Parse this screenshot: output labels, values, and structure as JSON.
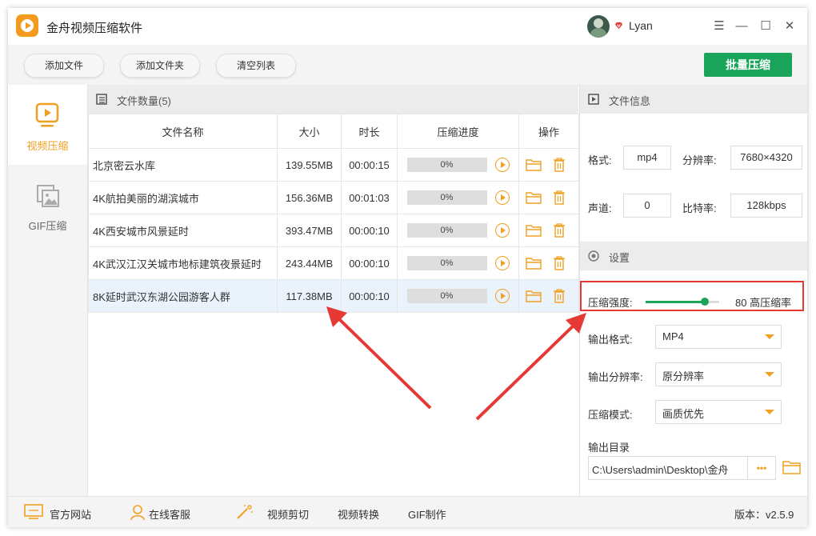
{
  "app": {
    "title": "金舟视频压缩软件",
    "username": "Lyan"
  },
  "window_controls": {
    "menu": "☰",
    "minimize": "—",
    "maximize": "☐",
    "close": "✕"
  },
  "toolbar": {
    "add_file": "添加文件",
    "add_folder": "添加文件夹",
    "clear_list": "清空列表",
    "batch_compress": "批量压缩"
  },
  "nav": {
    "items": [
      {
        "label": "视频压缩",
        "icon": "video-play-icon",
        "active": true
      },
      {
        "label": "GIF压缩",
        "icon": "image-icon",
        "active": false
      }
    ]
  },
  "file_panel": {
    "header": "文件数量(5)",
    "columns": [
      "文件名称",
      "大小",
      "时长",
      "压缩进度",
      "操作"
    ],
    "rows": [
      {
        "name": "北京密云水库",
        "size": "139.55MB",
        "duration": "00:00:15",
        "progress": "0%"
      },
      {
        "name": "4K航拍美丽的湖滨城市",
        "size": "156.36MB",
        "duration": "00:01:03",
        "progress": "0%"
      },
      {
        "name": "4K西安城市风景延时",
        "size": "393.47MB",
        "duration": "00:00:10",
        "progress": "0%"
      },
      {
        "name": "4K武汉江汉关城市地标建筑夜景延时",
        "size": "243.44MB",
        "duration": "00:00:10",
        "progress": "0%"
      },
      {
        "name": "8K延时武汉东湖公园游客人群",
        "size": "117.38MB",
        "duration": "00:00:10",
        "progress": "0%",
        "selected": true
      }
    ]
  },
  "file_info": {
    "header": "文件信息",
    "format_label": "格式:",
    "format": "mp4",
    "resolution_label": "分辨率:",
    "resolution": "7680×4320",
    "channel_label": "声道:",
    "channel": "0",
    "bitrate_label": "比特率:",
    "bitrate": "128kbps"
  },
  "settings": {
    "header": "设置",
    "strength_label": "压缩强度:",
    "strength_value": 80,
    "strength_text": "80 高压缩率",
    "output_format_label": "输出格式:",
    "output_format": "MP4",
    "output_resolution_label": "输出分辨率:",
    "output_resolution": "原分辨率",
    "mode_label": "压缩模式:",
    "mode": "画质优先",
    "output_dir_label": "输出目录",
    "output_dir": "C:\\Users\\admin\\Desktop\\金舟",
    "browse": "•••"
  },
  "bottom": {
    "website": "官方网站",
    "support": "在线客服",
    "video_cut": "视频剪切",
    "video_convert": "视频转换",
    "gif_make": "GIF制作",
    "version": "版本：v2.5.9"
  },
  "colors": {
    "accent_green": "#1aa45a",
    "accent_orange": "#f0a020",
    "highlight_red": "#e53935",
    "selected_row": "#eaf3fb"
  }
}
